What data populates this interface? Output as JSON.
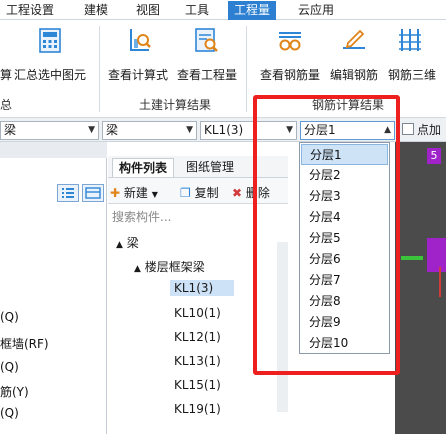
{
  "menu": {
    "items": [
      "工程设置",
      "建模",
      "视图",
      "工具",
      "工程量",
      "云应用"
    ],
    "active": "工程量"
  },
  "ribbon": {
    "left_cut_1": "算",
    "summary_selected": "汇总选中图元",
    "summary_group": "总",
    "view_formula": "查看计算式",
    "view_quantity": "查看工程量",
    "civil_group": "土建计算结果",
    "view_rebar_qty": "查看钢筋量",
    "edit_rebar": "编辑钢筋",
    "rebar_3d": "钢筋三维",
    "rebar_group": "钢筋计算结果"
  },
  "selectors": {
    "combo1": "梁",
    "combo2": "梁",
    "combo3": "KL1(3)",
    "combo4": "分层1",
    "checkbox_label": "点加"
  },
  "left_panel": {
    "items": [
      "(Q)",
      "框墙(RF)",
      "(Q)",
      "筋(Y)",
      "(Q)"
    ]
  },
  "component_panel": {
    "tab_list": "构件列表",
    "tab_drawings": "图纸管理",
    "toolbar_new": "新建",
    "toolbar_copy": "复制",
    "toolbar_delete": "删除",
    "search_placeholder": "搜索构件...",
    "tree_root": "梁",
    "tree_group": "楼层框架梁",
    "tree_items": [
      "KL1(3)",
      "KL10(1)",
      "KL12(1)",
      "KL13(1)",
      "KL15(1)",
      "KL19(1)"
    ],
    "selected_item": "KL1(3)"
  },
  "dropdown": {
    "options": [
      "分层1",
      "分层2",
      "分层3",
      "分层4",
      "分层5",
      "分层6",
      "分层7",
      "分层8",
      "分层9",
      "分层10"
    ],
    "selected": "分层1"
  },
  "colors": {
    "accent": "#2c7fd1",
    "highlight_box": "#ee1f1f",
    "selection": "#cfe3f7"
  }
}
